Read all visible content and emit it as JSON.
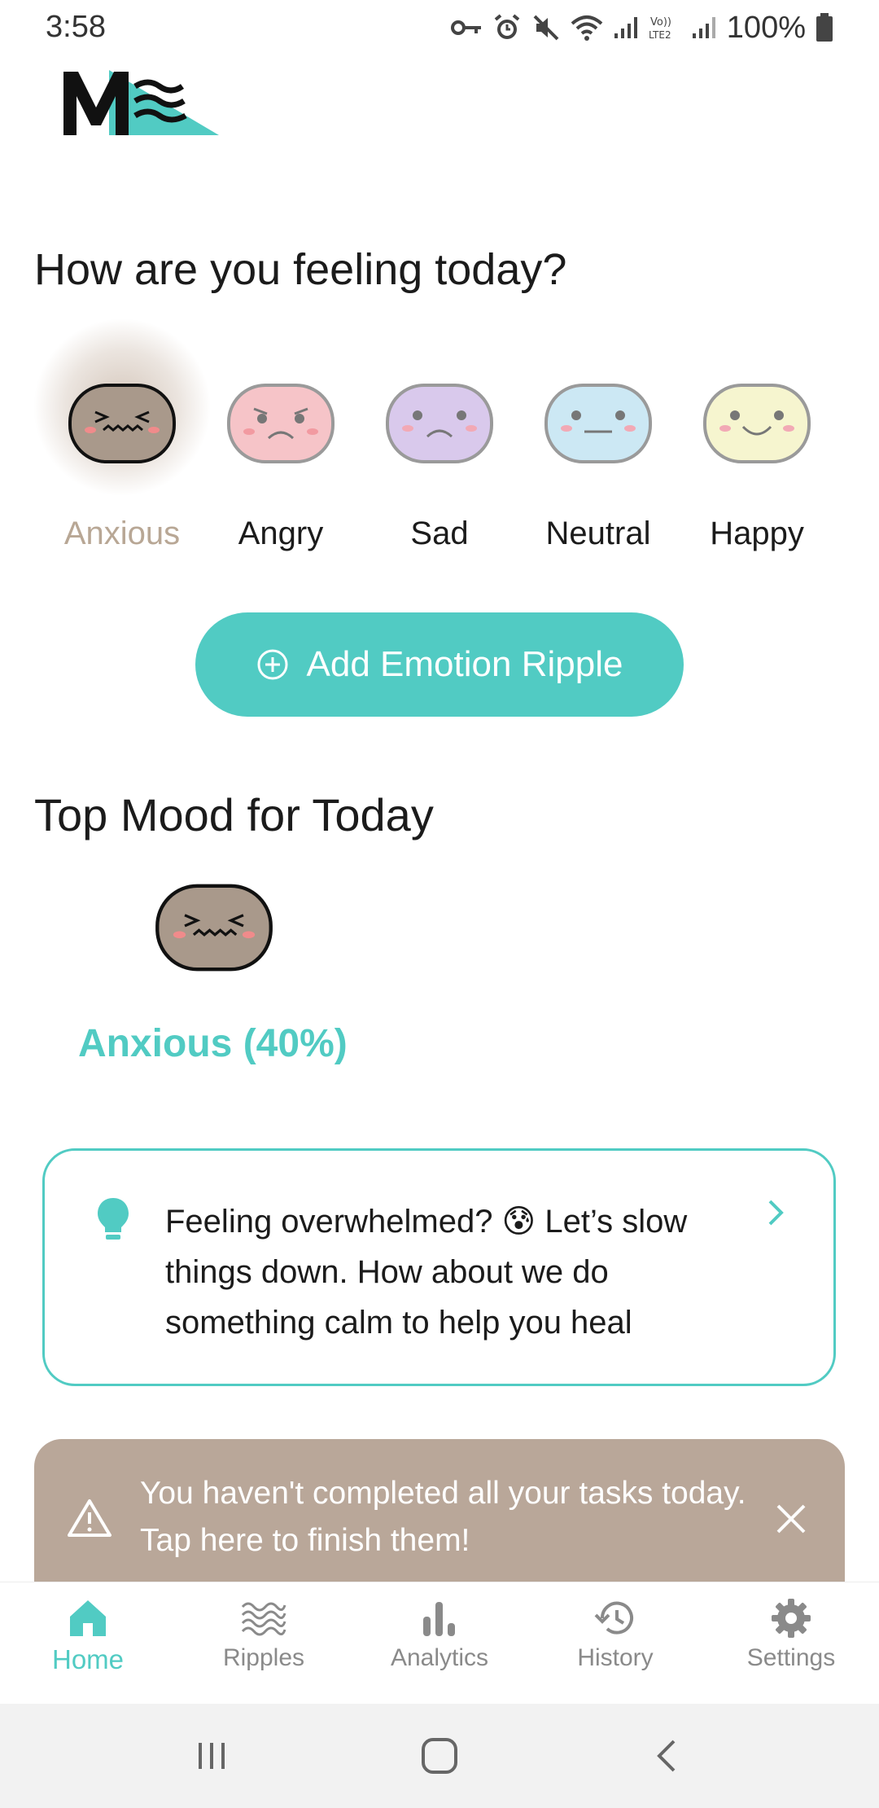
{
  "status_bar": {
    "time": "3:58",
    "battery": "100%",
    "icons": [
      "vpn-key-icon",
      "alarm-icon",
      "mute-icon",
      "wifi-icon",
      "signal-icon",
      "volte-icon",
      "signal-icon",
      "battery-icon"
    ]
  },
  "logo": {
    "icon": "app-logo-icon"
  },
  "mood_picker": {
    "title": "How are you feeling today?",
    "emotions": [
      {
        "label": "Anxious",
        "color": "#a9998b",
        "selected": true
      },
      {
        "label": "Angry",
        "color": "#f6c4c8",
        "selected": false
      },
      {
        "label": "Sad",
        "color": "#d9c9ec",
        "selected": false
      },
      {
        "label": "Neutral",
        "color": "#cce8f4",
        "selected": false
      },
      {
        "label": "Happy",
        "color": "#f6f5cf",
        "selected": false
      }
    ]
  },
  "add_button": {
    "label": "Add Emotion Ripple",
    "icon": "plus-circle-icon"
  },
  "top_mood": {
    "title": "Top Mood for Today",
    "label": "Anxious (40%)"
  },
  "tip": {
    "text": "Feeling overwhelmed? 😰 Let’s slow things down. How about we do something calm to help you heal",
    "icon": "lightbulb-icon"
  },
  "alert": {
    "text": "You haven't completed all your tasks today. Tap here to finish them!",
    "icon": "warning-icon",
    "close_icon": "close-icon"
  },
  "bottom_nav": {
    "items": [
      {
        "label": "Home",
        "icon": "home-icon",
        "active": true
      },
      {
        "label": "Ripples",
        "icon": "waves-icon",
        "active": false
      },
      {
        "label": "Analytics",
        "icon": "bar-chart-icon",
        "active": false
      },
      {
        "label": "History",
        "icon": "history-icon",
        "active": false
      },
      {
        "label": "Settings",
        "icon": "gear-icon",
        "active": false
      }
    ]
  },
  "colors": {
    "accent": "#51cbc3",
    "banner": "#b9a799",
    "selected_label": "#b8a795"
  }
}
